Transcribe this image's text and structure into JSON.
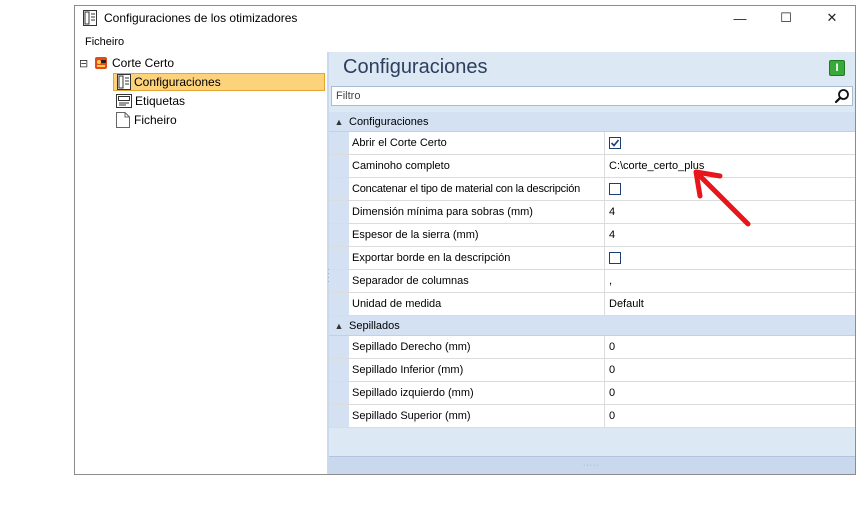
{
  "window": {
    "title": "Configuraciones de los otimizadores",
    "minimize_glyph": "—",
    "maximize_glyph": "☐",
    "close_glyph": "✕"
  },
  "menu": {
    "items": [
      "Ficheiro"
    ]
  },
  "tree": {
    "root": {
      "label": "Corte Certo",
      "expander": "⊟",
      "icon": "app-logo-icon"
    },
    "children": [
      {
        "label": "Configuraciones",
        "icon": "config-icon",
        "selected": true
      },
      {
        "label": "Etiquetas",
        "icon": "label-icon",
        "selected": false
      },
      {
        "label": "Ficheiro",
        "icon": "file-icon",
        "selected": false
      }
    ]
  },
  "panel": {
    "title": "Configuraciones",
    "info_label": "I",
    "filter_placeholder": "Filtro"
  },
  "grid": {
    "categories": [
      {
        "name": "Configuraciones",
        "chevron": "▲",
        "rows": [
          {
            "name": "Abrir el Corte Certo",
            "value": "",
            "checkbox": true,
            "checked": true
          },
          {
            "name": "Caminoho completo",
            "value": "C:\\corte_certo_plus"
          },
          {
            "name": "Concatenar el tipo de material con la descripción",
            "value": "",
            "checkbox": true,
            "checked": false
          },
          {
            "name": "Dimensión mínima para sobras (mm)",
            "value": "4"
          },
          {
            "name": "Espesor de la sierra (mm)",
            "value": "4"
          },
          {
            "name": "Exportar borde en la descripción",
            "value": "",
            "checkbox": true,
            "checked": false
          },
          {
            "name": "Separador de columnas",
            "value": ","
          },
          {
            "name": "Unidad de medida",
            "value": "Default"
          }
        ]
      },
      {
        "name": "Sepillados",
        "chevron": "▲",
        "rows": [
          {
            "name": "Sepillado Derecho (mm)",
            "value": "0"
          },
          {
            "name": "Sepillado Inferior (mm)",
            "value": "0"
          },
          {
            "name": "Sepillado izquierdo (mm)",
            "value": "0"
          },
          {
            "name": "Sepillado Superior (mm)",
            "value": "0"
          }
        ]
      }
    ]
  },
  "colors": {
    "accent_red": "#e8151b",
    "selection": "#fcd27a",
    "panel_bg": "#dde8f5",
    "title_text": "#2d3f5c"
  }
}
